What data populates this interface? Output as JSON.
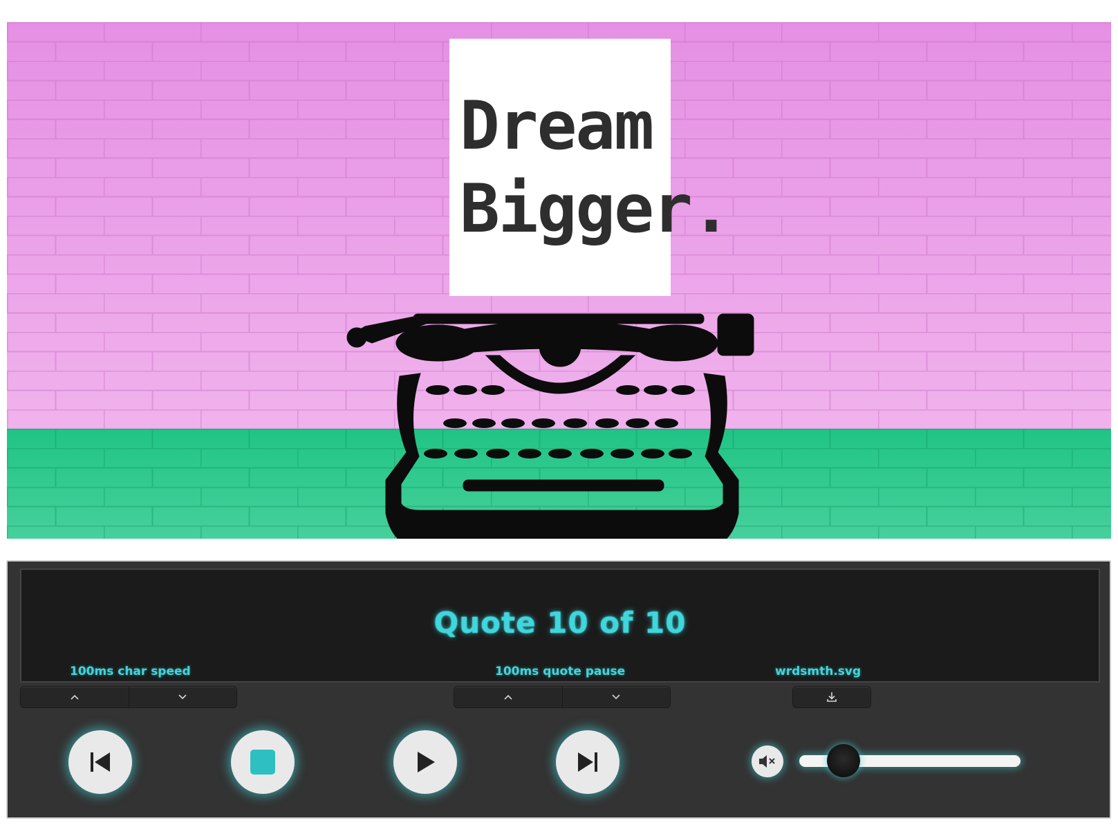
{
  "scene": {
    "quote_line_1": "Dream",
    "quote_line_2": "Bigger.",
    "wall_color": "#ee9ee8",
    "floor_color": "#29c98d"
  },
  "player": {
    "status": "Quote 10 of 10",
    "char_speed_label": "100ms char speed",
    "quote_pause_label": "100ms quote pause",
    "download_label": "wrdsmth.svg",
    "accent_color": "#3fd6dc",
    "volume": 0.2,
    "icons": {
      "increase": "chevron-up-icon",
      "decrease": "chevron-down-icon",
      "download": "download-icon",
      "previous": "skip-previous-icon",
      "stop": "stop-icon",
      "play": "play-icon",
      "next": "skip-next-icon",
      "mute": "volume-muted-icon"
    }
  }
}
